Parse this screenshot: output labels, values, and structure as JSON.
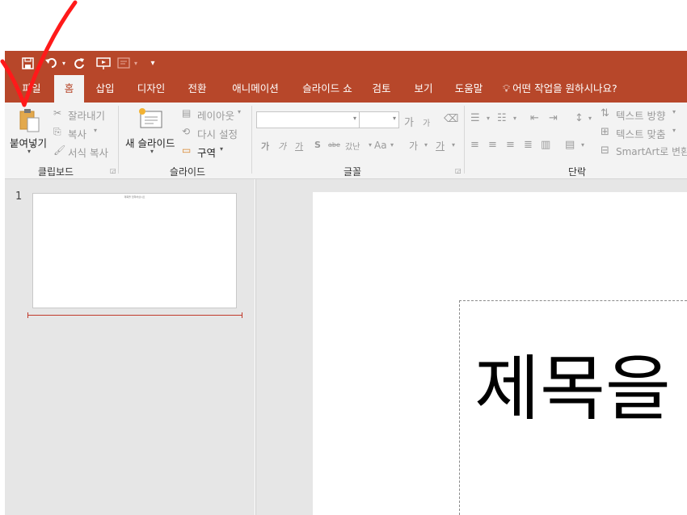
{
  "qat": {
    "icons": [
      "save-icon",
      "undo-icon",
      "redo-icon",
      "start-from-beginning-icon",
      "touch-mode-icon",
      "customize-qat-icon"
    ]
  },
  "tabs": [
    "파일",
    "홈",
    "삽입",
    "디자인",
    "전환",
    "애니메이션",
    "슬라이드 쇼",
    "검토",
    "보기",
    "도움말"
  ],
  "tell_me": "어떤 작업을 원하시나요?",
  "ribbon": {
    "clipboard": {
      "paste": "붙여넣기",
      "cut": "잘라내기",
      "copy": "복사",
      "format_painter": "서식 복사",
      "group": "클립보드"
    },
    "slides": {
      "new_slide": "새 슬라이드",
      "layout": "레이아웃",
      "reset": "다시 설정",
      "section": "구역",
      "group": "슬라이드"
    },
    "font": {
      "group": "글꼴",
      "grow": "가",
      "shrink": "가",
      "bold": "가",
      "italic": "가",
      "underline": "가",
      "shadow": "S",
      "strike": "abe",
      "spacing": "갔난",
      "change_case": "Aa",
      "highlight": "가",
      "font_color": "가"
    },
    "paragraph": {
      "text_direction": "텍스트 방향",
      "align_text": "텍스트 맞춤",
      "smartart": "SmartArt로 변환",
      "group": "단락"
    }
  },
  "thumbnails": [
    {
      "number": "1",
      "title": "제목을 입력하십시오"
    }
  ],
  "slide": {
    "title_visible": "제목을"
  },
  "colors": {
    "brand": "#b7472a",
    "ribbon_bg": "#f3f3f3",
    "pane_bg": "#e6e6e6",
    "annotation": "#ff1a1a"
  }
}
